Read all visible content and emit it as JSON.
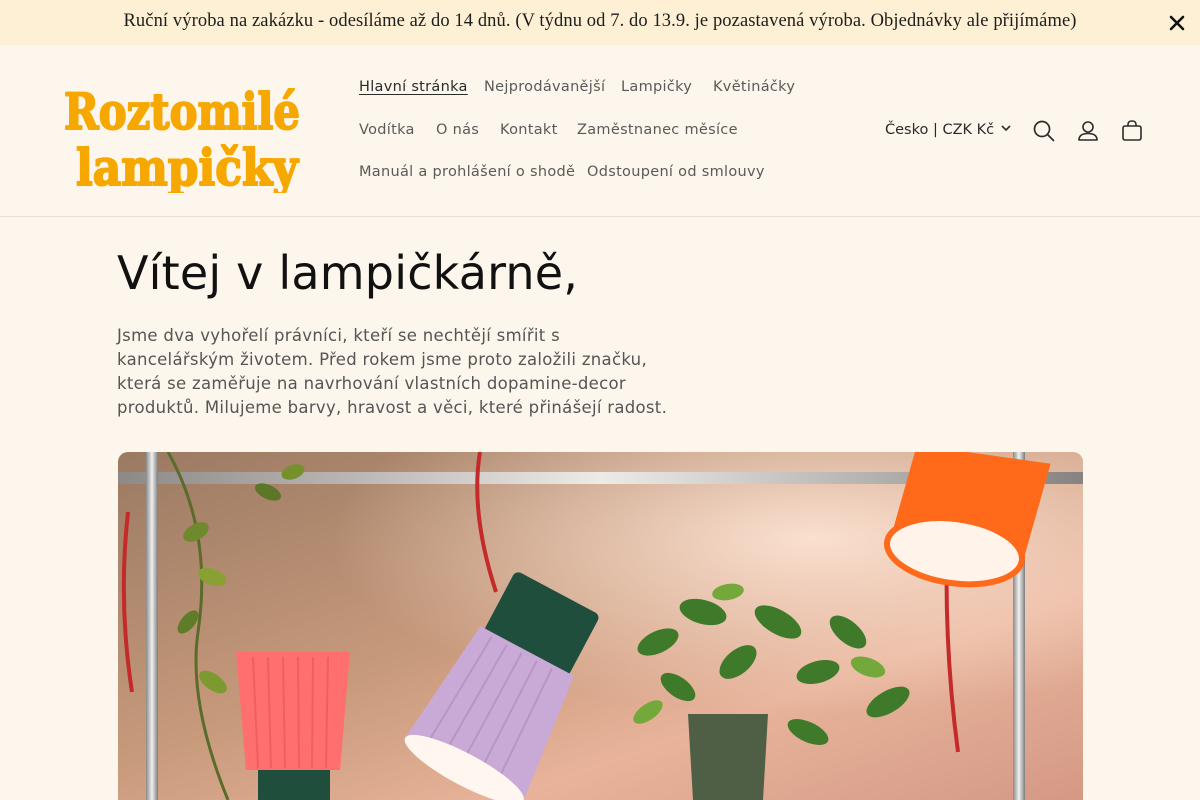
{
  "announcement": {
    "text": "Ruční výroba na zakázku - odesíláme až do 14 dnů. (V týdnu od 7. do 13.9. je pozastavená výroba. Objednávky ale přijímáme)",
    "close_icon": "close-icon"
  },
  "logo": {
    "line1": "Roztomilé",
    "line2": "lampičky",
    "color": "#f6a700"
  },
  "nav": {
    "items": [
      {
        "label": "Hlavní stránka",
        "active": true
      },
      {
        "label": "Nejprodávanější"
      },
      {
        "label": "Lampičky"
      },
      {
        "label": "Květináčky"
      },
      {
        "label": "Vodítka"
      },
      {
        "label": "O nás"
      },
      {
        "label": "Kontakt"
      },
      {
        "label": "Zaměstnanec měsíce"
      },
      {
        "label": "Manuál a prohlášení o shodě"
      },
      {
        "label": "Odstoupení od smlouvy"
      }
    ]
  },
  "header": {
    "country_selector": "Česko | CZK Kč",
    "icons": [
      "search-icon",
      "account-icon",
      "cart-icon"
    ]
  },
  "main": {
    "title": "Vítej v lampičkárně,",
    "text": "Jsme dva vyhořelí právníci, kteří se nechtějí smířit s kancelářským životem. Před rokem jsme proto založili značku, která se zaměřuje na navrhování vlastních dopamine-decor produktů. Milujeme barvy, hravost a věci, které přinášejí radost."
  },
  "colors": {
    "background": "#fdf6ec",
    "announcement_bg": "#fdf0d5",
    "logo_yellow": "#f6a700",
    "lamp_orange": "#ff6a1a",
    "lamp_pink": "#ff6f6f",
    "lamp_lilac": "#c9a9d6",
    "lamp_green": "#1f4e3d"
  }
}
